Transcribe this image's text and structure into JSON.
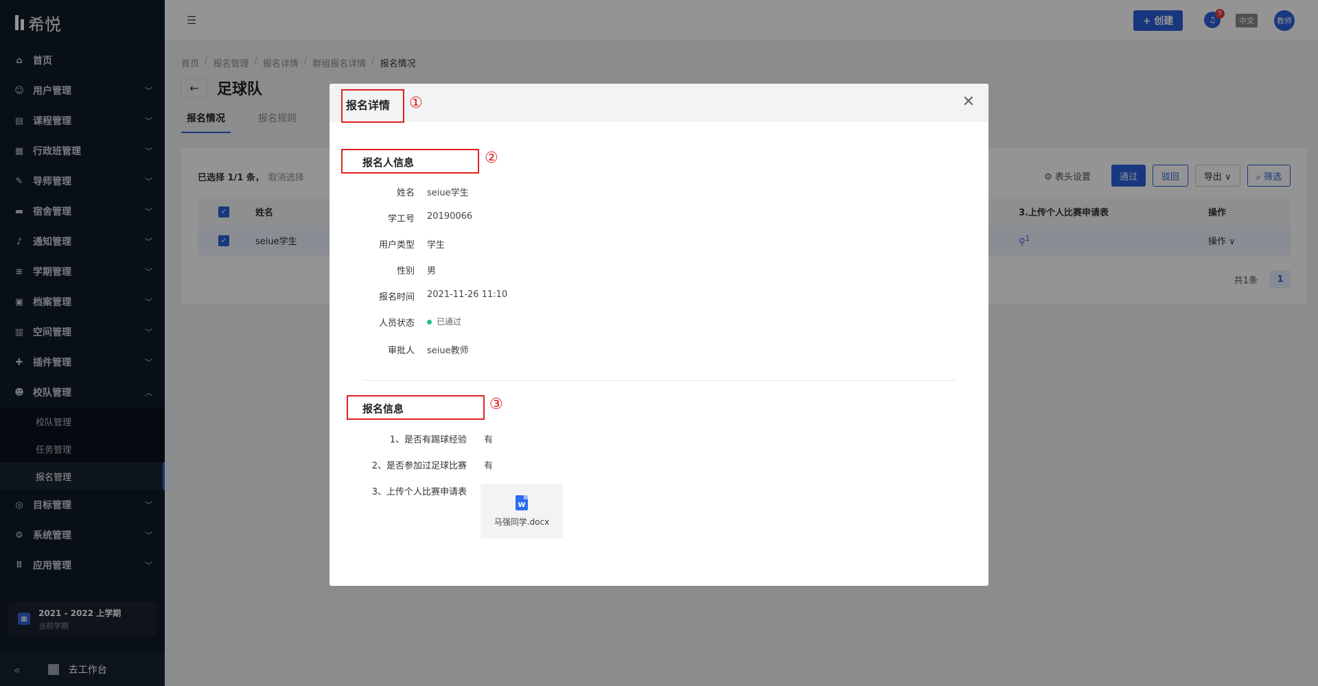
{
  "brand": {
    "name": "希悦"
  },
  "sidebar": {
    "items": [
      {
        "label": "首页",
        "icon": "home-icon",
        "glyph": "⌂"
      },
      {
        "label": "用户管理",
        "icon": "user-icon",
        "glyph": "☺"
      },
      {
        "label": "课程管理",
        "icon": "book-icon",
        "glyph": "▤"
      },
      {
        "label": "行政班管理",
        "icon": "class-icon",
        "glyph": "▦"
      },
      {
        "label": "导师管理",
        "icon": "mentor-icon",
        "glyph": "✎"
      },
      {
        "label": "宿舍管理",
        "icon": "bed-icon",
        "glyph": "▬"
      },
      {
        "label": "通知管理",
        "icon": "bell-icon",
        "glyph": "♪"
      },
      {
        "label": "学期管理",
        "icon": "layers-icon",
        "glyph": "≋"
      },
      {
        "label": "档案管理",
        "icon": "archive-icon",
        "glyph": "▣"
      },
      {
        "label": "空间管理",
        "icon": "building-icon",
        "glyph": "▥"
      },
      {
        "label": "插件管理",
        "icon": "plugin-icon",
        "glyph": "✚"
      },
      {
        "label": "校队管理",
        "icon": "team-icon",
        "glyph": "☻"
      }
    ],
    "sub_items": [
      {
        "label": "校队管理"
      },
      {
        "label": "任务管理"
      },
      {
        "label": "报名管理"
      }
    ],
    "items_after": [
      {
        "label": "目标管理",
        "icon": "target-icon",
        "glyph": "◎"
      },
      {
        "label": "系统管理",
        "icon": "settings-icon",
        "glyph": "⚙"
      },
      {
        "label": "应用管理",
        "icon": "apps-icon",
        "glyph": "⠿"
      }
    ],
    "term": {
      "title": "2021 - 2022 上学期",
      "subtitle": "当前学期"
    },
    "footer": {
      "collapse": "«",
      "workbench": "去工作台"
    }
  },
  "header": {
    "create_label": "+ 创建",
    "notification_count": "5",
    "lang": "中文",
    "avatar": "教师"
  },
  "breadcrumb": [
    "首页",
    "报名管理",
    "报名详情",
    "群组报名详情",
    "报名情况"
  ],
  "page": {
    "title": "足球队",
    "tabs": [
      "报名情况",
      "报名规则"
    ]
  },
  "table_area": {
    "selected_text": "已选择 1/1 条，",
    "cancel_select": "取消选择",
    "column_settings": "⚙ 表头设置",
    "approve": "通过",
    "reject": "驳回",
    "export": "导出 ∨",
    "filter": "⌕ 筛选",
    "columns": {
      "name": "姓名",
      "upload": "3.上传个人比赛申请表",
      "op": "操作"
    },
    "rows": [
      {
        "name": "seiue学生",
        "attach_count": "1",
        "op": "操作 ∨"
      }
    ],
    "total": "共1条",
    "page": "1"
  },
  "modal": {
    "title": "报名详情",
    "close": "✕",
    "markers": [
      "①",
      "②",
      "③"
    ],
    "applicant_section": "报名人信息",
    "fields": [
      {
        "label": "姓名",
        "value": "seiue学生"
      },
      {
        "label": "学工号",
        "value": "20190066"
      },
      {
        "label": "用户类型",
        "value": "学生"
      },
      {
        "label": "性别",
        "value": "男"
      },
      {
        "label": "报名时间",
        "value": "2021-11-26 11:10"
      },
      {
        "label": "人员状态",
        "value": "已通过"
      },
      {
        "label": "审批人",
        "value": "seiue教师"
      }
    ],
    "info_section": "报名信息",
    "answers": [
      {
        "q": "1、是否有踢球经验",
        "a": "有"
      },
      {
        "q": "2、是否参加过足球比赛",
        "a": "有"
      },
      {
        "q": "3、上传个人比赛申请表",
        "a": ""
      }
    ],
    "file": {
      "icon_letter": "W",
      "name": "马强同学.docx"
    }
  },
  "colors": {
    "accent": "#2b5fd9",
    "sidebar_bg": "#0f1a28",
    "status_ok": "#1fbf8f",
    "annotation": "#e02020"
  }
}
